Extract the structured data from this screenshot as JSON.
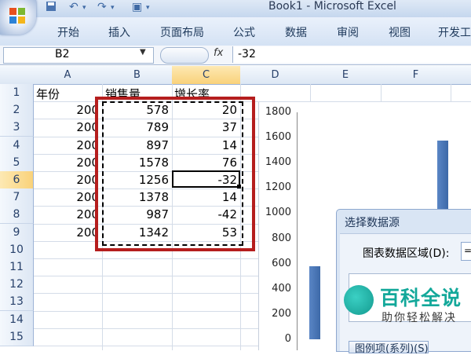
{
  "window": {
    "title": "Book1 - Microsoft Excel"
  },
  "ribbon": {
    "tabs": [
      "开始",
      "插入",
      "页面布局",
      "公式",
      "数据",
      "审阅",
      "视图",
      "开发工"
    ]
  },
  "formula_bar": {
    "name_box": "B2",
    "fx": "fx",
    "value": "-32"
  },
  "columns": [
    "A",
    "B",
    "C",
    "D",
    "E",
    "F"
  ],
  "rows": [
    "1",
    "2",
    "3",
    "4",
    "5",
    "6",
    "7",
    "8",
    "9",
    "10",
    "11",
    "12",
    "13",
    "14",
    "15"
  ],
  "sheet": {
    "headers": {
      "a": "年份",
      "b": "销售量",
      "c": "增长率"
    },
    "data": [
      {
        "a": "200",
        "b": "578",
        "c": "20"
      },
      {
        "a": "200",
        "b": "789",
        "c": "37"
      },
      {
        "a": "200",
        "b": "897",
        "c": "14"
      },
      {
        "a": "200",
        "b": "1578",
        "c": "76"
      },
      {
        "a": "200",
        "b": "1256",
        "c": "-32"
      },
      {
        "a": "200",
        "b": "1378",
        "c": "14"
      },
      {
        "a": "200",
        "b": "987",
        "c": "-42"
      },
      {
        "a": "200",
        "b": "1342",
        "c": "53"
      }
    ]
  },
  "chart": {
    "y_ticks": [
      "1800",
      "1600",
      "1400",
      "1200",
      "1000",
      "800",
      "600",
      "400",
      "200",
      "0"
    ],
    "y_max": 1800,
    "bars": [
      {
        "value": 578,
        "color": "#4f7cbd"
      },
      {
        "value": 1578,
        "color": "#4f7cbd"
      }
    ]
  },
  "dialog": {
    "title": "选择数据源",
    "range_label": "图表数据区域(D):",
    "range_value": "=",
    "legend_label": "图例项(系列)(S)"
  },
  "watermark": {
    "title": "百科全说",
    "subtitle": "助你轻松解决"
  },
  "colors": {
    "highlight_box": "#b51e1e",
    "ribbon": "#dfe9f6",
    "bar": "#4f7cbd"
  }
}
